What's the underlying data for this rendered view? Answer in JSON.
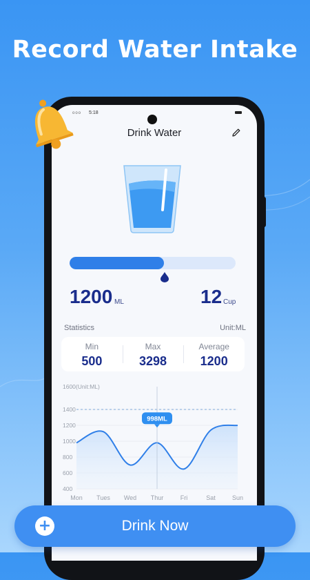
{
  "headline": "Record Water Intake",
  "status_bar": {
    "time": "5:18",
    "dots": "ooo"
  },
  "app": {
    "title": "Drink Water",
    "progress": 0.57,
    "intake": {
      "amount": "1200",
      "amount_unit": "ML",
      "cups": "12",
      "cups_unit": "Cup"
    },
    "stats": {
      "label": "Statistics",
      "unit": "Unit:ML",
      "items": [
        {
          "label": "Min",
          "value": "500"
        },
        {
          "label": "Max",
          "value": "3298"
        },
        {
          "label": "Average",
          "value": "1200"
        }
      ]
    }
  },
  "chart_data": {
    "type": "area",
    "title": "",
    "ylabel": "1600(Unit:ML)",
    "ylim": [
      400,
      1600
    ],
    "yticks": [
      400,
      600,
      800,
      1000,
      1200,
      1400
    ],
    "categories": [
      "Mon",
      "Tues",
      "Wed",
      "Thur",
      "Fri",
      "Sat",
      "Sun"
    ],
    "series": [
      {
        "values": [
          980,
          1120,
          700,
          980,
          650,
          1140,
          1200
        ]
      }
    ],
    "reference_line": 1400,
    "highlight": {
      "category": "Thur",
      "label": "998ML"
    }
  },
  "cta": {
    "label": "Drink Now"
  },
  "colors": {
    "primary": "#2f7fe8",
    "text_dark": "#1a2d8c",
    "bell": "#f5a623"
  }
}
